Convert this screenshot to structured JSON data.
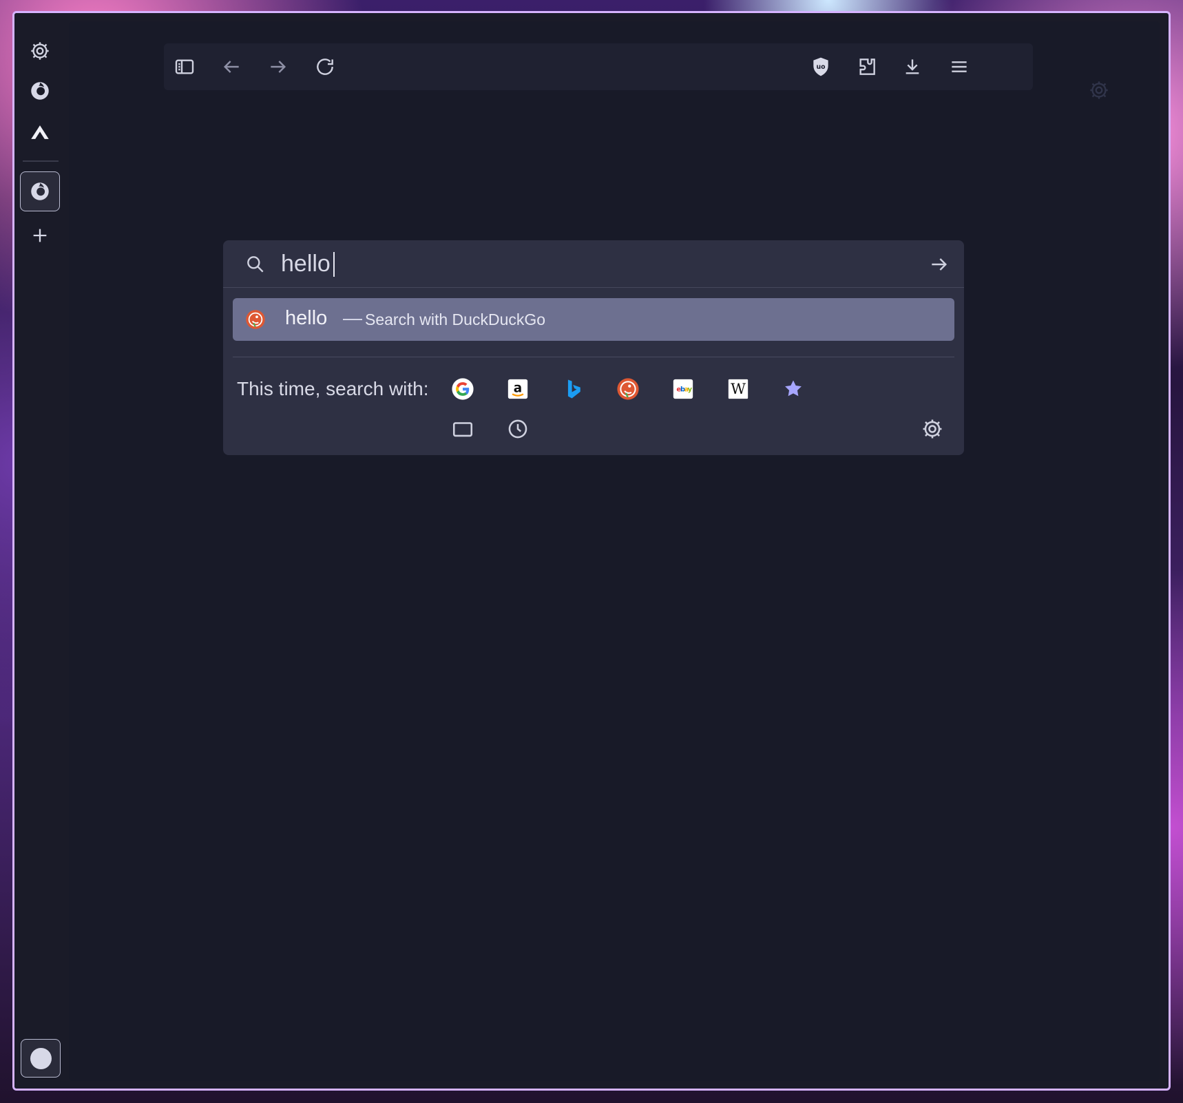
{
  "colors": {
    "accent": "#a7a6ff",
    "frame_border": "#d6b3ff",
    "app_bg": "#181a28",
    "panel_bg": "#2e3043",
    "suggestion_bg": "#6d7090",
    "text": "#d8d9e6"
  },
  "sidebar": {
    "items": [
      {
        "icon": "gear-icon"
      },
      {
        "icon": "firefox-icon"
      },
      {
        "icon": "mountain-icon"
      },
      {
        "icon": "firefox-icon",
        "active": true
      },
      {
        "icon": "plus-icon"
      }
    ],
    "footer_icon": "moon-icon"
  },
  "toolbar": {
    "left_icons": [
      "sidebar-toggle-icon",
      "back-arrow-icon",
      "forward-arrow-icon",
      "reload-icon"
    ],
    "right_icons": [
      "ublock-shield-icon",
      "extensions-puzzle-icon",
      "download-icon",
      "hamburger-menu-icon"
    ]
  },
  "page": {
    "settings_icon": "gear-icon"
  },
  "search": {
    "value": "hello",
    "suggestion": {
      "term": "hello",
      "dash": "—",
      "action": "Search with DuckDuckGo"
    },
    "one_off_label": "This time, search with:",
    "engines": [
      {
        "name": "google",
        "icon": "google-icon"
      },
      {
        "name": "amazon",
        "icon": "amazon-icon"
      },
      {
        "name": "bing",
        "icon": "bing-icon"
      },
      {
        "name": "duckduckgo",
        "icon": "duckduckgo-icon"
      },
      {
        "name": "ebay",
        "icon": "ebay-icon"
      },
      {
        "name": "wikipedia",
        "icon": "wikipedia-icon"
      },
      {
        "name": "bookmarks",
        "icon": "star-icon"
      }
    ],
    "bottom_actions": [
      {
        "name": "tabs",
        "icon": "tab-icon"
      },
      {
        "name": "history",
        "icon": "clock-icon"
      }
    ],
    "settings_icon": "gear-icon"
  }
}
